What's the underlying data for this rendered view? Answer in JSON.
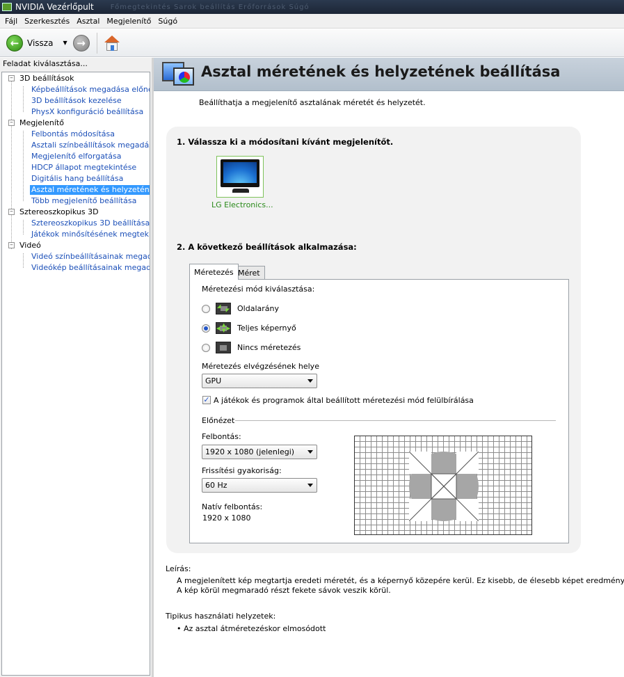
{
  "window": {
    "title": "NVIDIA Vezérlőpult",
    "ghost_menu": "Főmegtekintés  Sarok beállítás  Erőforrások  Súgó"
  },
  "menu": [
    "Fájl",
    "Szerkesztés",
    "Asztal",
    "Megjelenítő",
    "Súgó"
  ],
  "toolbar": {
    "back_label": "Vissza"
  },
  "sidebar": {
    "header": "Feladat kiválasztása...",
    "groups": [
      {
        "label": "3D beállítások",
        "items": [
          "Képbeállítások megadása előnézettel",
          "3D beállítások kezelése",
          "PhysX konfiguráció beállítása"
        ]
      },
      {
        "label": "Megjelenítő",
        "items": [
          "Felbontás módosítása",
          "Asztali színbeállítások megadása",
          "Megjelenítő elforgatása",
          "HDCP állapot megtekintése",
          "Digitális hang beállítása",
          "Asztal méretének és helyzetének beállítása",
          "Több megjelenítő beállítása"
        ]
      },
      {
        "label": "Sztereoszkopikus 3D",
        "items": [
          "Sztereoszkopikus 3D beállítása",
          "Játékok minősítésének megtekintése"
        ]
      },
      {
        "label": "Videó",
        "items": [
          "Videó színbeállításainak megadása",
          "Videókép beállításainak megadása"
        ]
      }
    ]
  },
  "page": {
    "title": "Asztal méretének és helyzetének beállítása",
    "subtitle": "Beállíthatja a megjelenítő asztalának méretét és helyzetét.",
    "step1": "1. Válassza ki a módosítani kívánt megjelenítőt.",
    "display_name": "LG Electronics...",
    "step2": "2. A következő beállítások alkalmazása:",
    "tabs": [
      "Méretezés",
      "Méret"
    ],
    "scaling_mode_label": "Méretezési mód kiválasztása:",
    "modes": [
      "Oldalarány",
      "Teljes képernyő",
      "Nincs méretezés"
    ],
    "selected_mode": "Teljes képernyő",
    "perform_on_label": "Méretezés elvégzésének helye",
    "perform_on_value": "GPU",
    "override_label": "A játékok és programok által beállított méretezési mód felülbírálása",
    "override_checked": true,
    "preview_label": "Előnézet",
    "resolution_label": "Felbontás:",
    "resolution_value": "1920 x 1080 (jelenlegi)",
    "refresh_label": "Frissítési gyakoriság:",
    "refresh_value": "60 Hz",
    "native_label": "Natív felbontás:",
    "native_value": "1920 x 1080",
    "description_head": "Leírás:",
    "description_lines": [
      "A megjelenített kép megtartja eredeti méretét, és a képernyő közepére kerül. Ez kisebb, de élesebb képet eredményezhet.",
      "A kép körül megmaradó részt fekete sávok veszik körül."
    ],
    "usage_head": "Tipikus használati helyzetek:",
    "usage_items": [
      "Az asztal átméretezéskor elmosódott"
    ]
  },
  "colors": {
    "link": "#1b4fb8",
    "selection": "#3399ff",
    "banner": "#b2bfcc",
    "display_label": "#2a8a1a"
  }
}
